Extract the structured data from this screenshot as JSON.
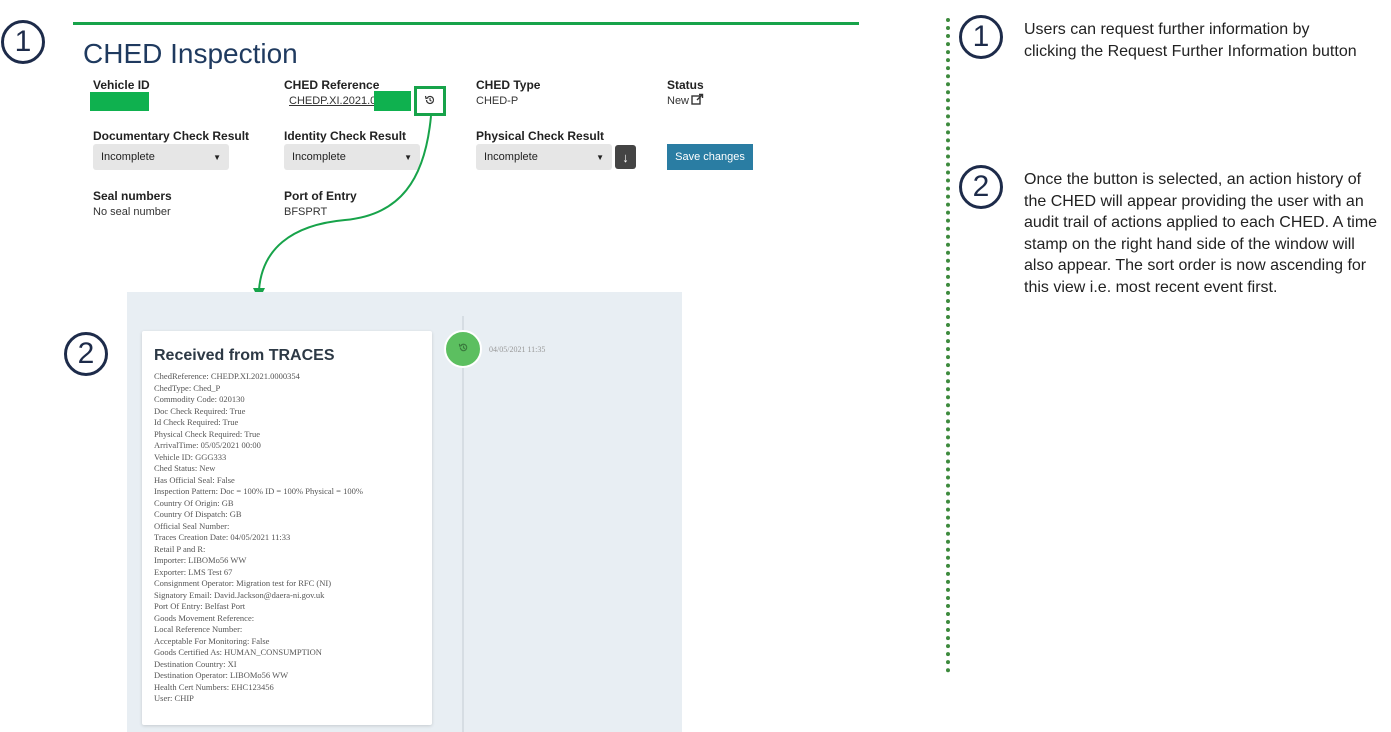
{
  "steps": {
    "one": "1",
    "two": "2"
  },
  "page": {
    "title": "CHED Inspection"
  },
  "fields": {
    "vehicle_id_label": "Vehicle ID",
    "ched_reference_label": "CHED Reference",
    "ched_reference_value": "CHEDP.XI.2021.00",
    "ched_type_label": "CHED Type",
    "ched_type_value": "CHED-P",
    "status_label": "Status",
    "status_value": "New",
    "doc_check_label": "Documentary Check Result",
    "doc_check_value": "Incomplete",
    "identity_check_label": "Identity Check Result",
    "identity_check_value": "Incomplete",
    "physical_check_label": "Physical Check Result",
    "physical_check_value": "Incomplete",
    "save_button": "Save changes",
    "seal_label": "Seal numbers",
    "seal_value": "No seal number",
    "port_label": "Port of Entry",
    "port_value": "BFSPRT"
  },
  "icons": {
    "history": "history-icon",
    "external_link": "external-link-icon",
    "download": "download-arrow-icon"
  },
  "history": {
    "event_title": "Received from TRACES",
    "timestamp": "04/05/2021 11:35",
    "lines": [
      "ChedReference: CHEDP.XI.2021.0000354",
      "ChedType: Ched_P",
      "Commodity Code: 020130",
      "Doc Check Required: True",
      "Id Check Required: True",
      "Physical Check Required: True",
      "ArrivalTime: 05/05/2021 00:00",
      "Vehicle ID: GGG333",
      "Ched Status: New",
      "Has Official Seal: False",
      "Inspection Pattern: Doc = 100% ID = 100% Physical = 100%",
      "Country Of Origin: GB",
      "Country Of Dispatch: GB",
      "Official Seal Number:",
      "Traces Creation Date: 04/05/2021 11:33",
      "Retail P and R:",
      "Importer: LIBOMo56 WW",
      "Exporter: LMS Test 67",
      "Consignment Operator: Migration test for RFC (NI)",
      "Signatory Email: David.Jackson@daera-ni.gov.uk",
      "Port Of Entry: Belfast Port",
      "Goods Movement Reference:",
      "Local Reference Number:",
      "Acceptable For Monitoring: False",
      "Goods Certified As: HUMAN_CONSUMPTION",
      "Destination Country: XI",
      "Destination Operator: LIBOMo56 WW",
      "Health Cert Numbers: EHC123456",
      "User: CHIP"
    ]
  },
  "notes": {
    "one": "Users can request further information by clicking the Request Further Information button",
    "two": "Once the button is selected, an action history of the CHED will appear providing the user with an audit trail of actions applied to each CHED. A time stamp on the right hand side of the window will also appear. The sort order is now ascending for this view i.e. most recent event first."
  },
  "colors": {
    "accent_green": "#17a34a",
    "redaction_green": "#0fb14f",
    "save_button": "#2a7da3",
    "title_blue": "#1f3a5f",
    "timeline_dot": "#5cbf60"
  }
}
